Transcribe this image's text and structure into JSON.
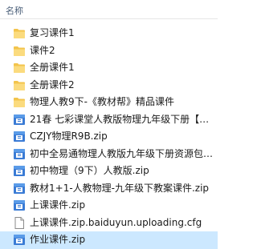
{
  "header": {
    "column_name": "名称"
  },
  "files": [
    {
      "name": "复习课件1",
      "type": "folder"
    },
    {
      "name": "课件2",
      "type": "folder"
    },
    {
      "name": "全册课件1",
      "type": "folder"
    },
    {
      "name": "全册课件2",
      "type": "folder"
    },
    {
      "name": "物理人教9下-《教材帮》精品课件",
      "type": "folder"
    },
    {
      "name": "21春 七彩课堂人教版物理九年级下册【…",
      "type": "zip"
    },
    {
      "name": "CZJY物理R9B.zip",
      "type": "zip"
    },
    {
      "name": "初中全易通物理人教版九年级下册资源包…",
      "type": "zip"
    },
    {
      "name": "初中物理（9下）人教版.zip",
      "type": "zip"
    },
    {
      "name": "教材1+1-人教物理-九年级下教案课件.zip",
      "type": "zip"
    },
    {
      "name": "上课课件.zip",
      "type": "zip"
    },
    {
      "name": "上课课件.zip.baiduyun.uploading.cfg",
      "type": "file"
    },
    {
      "name": "作业课件.zip",
      "type": "zip",
      "selected": true
    }
  ],
  "colors": {
    "folder": "#f8d775",
    "selected_row": "#cce8ff",
    "header_text": "#4c607a"
  }
}
